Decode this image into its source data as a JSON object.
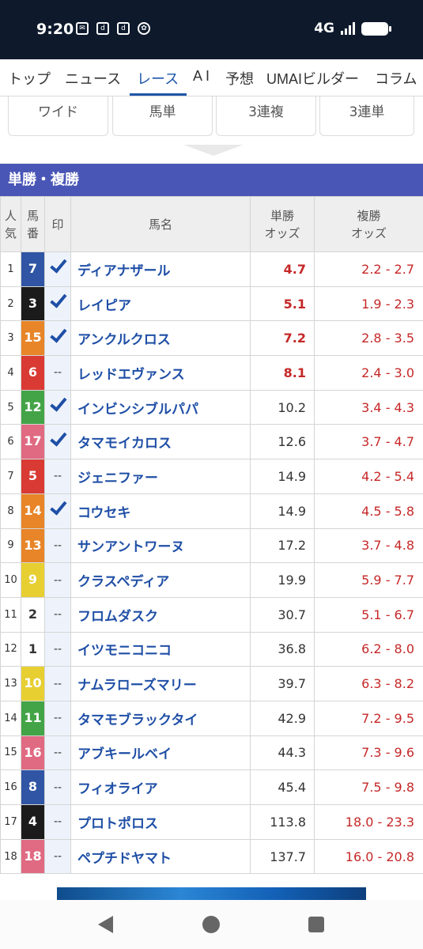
{
  "status": {
    "time": "9:20",
    "network": "4G",
    "left_icons": [
      "mail-icon",
      "d-icon",
      "d-icon",
      "pinwheel-icon"
    ]
  },
  "nav": {
    "items": [
      "トップ",
      "ニュース",
      "レース",
      "A I",
      "予想",
      "UMAIビルダー",
      "コラム"
    ],
    "active": "レース"
  },
  "bet_tabs": [
    "ワイド",
    "馬単",
    "3連複",
    "3連単"
  ],
  "section_title": "単勝・複勝",
  "table": {
    "headers": {
      "pop": [
        "人",
        "気"
      ],
      "num": [
        "馬",
        "番"
      ],
      "mark": "印",
      "name": "馬名",
      "win": [
        "単勝",
        "オッズ"
      ],
      "place": [
        "複勝",
        "オッズ"
      ]
    },
    "rows": [
      {
        "pop": "1",
        "num": "7",
        "mark": "check",
        "name": "ディアナザール",
        "win": "4.7",
        "place": "2.2 - 2.7",
        "win_hi": true,
        "bg": "#2f55a4",
        "fg": "#ffffff"
      },
      {
        "pop": "2",
        "num": "3",
        "mark": "check",
        "name": "レイピア",
        "win": "5.1",
        "place": "1.9 - 2.3",
        "win_hi": true,
        "bg": "#1b1b1b",
        "fg": "#ffffff"
      },
      {
        "pop": "3",
        "num": "15",
        "mark": "check",
        "name": "アンクルクロス",
        "win": "7.2",
        "place": "2.8 - 3.5",
        "win_hi": true,
        "bg": "#e78528",
        "fg": "#ffffff"
      },
      {
        "pop": "4",
        "num": "6",
        "mark": "--",
        "name": "レッドエヴァンス",
        "win": "8.1",
        "place": "2.4 - 3.0",
        "win_hi": true,
        "bg": "#d93a34",
        "fg": "#ffffff"
      },
      {
        "pop": "5",
        "num": "12",
        "mark": "check",
        "name": "インビンシブルパパ",
        "win": "10.2",
        "place": "3.4 - 4.3",
        "win_hi": false,
        "bg": "#43a447",
        "fg": "#ffffff"
      },
      {
        "pop": "6",
        "num": "17",
        "mark": "check",
        "name": "タマモイカロス",
        "win": "12.6",
        "place": "3.7 - 4.7",
        "win_hi": false,
        "bg": "#e06a82",
        "fg": "#ffffff"
      },
      {
        "pop": "7",
        "num": "5",
        "mark": "--",
        "name": "ジェニファー",
        "win": "14.9",
        "place": "4.2 - 5.4",
        "win_hi": false,
        "bg": "#d93a34",
        "fg": "#ffffff"
      },
      {
        "pop": "8",
        "num": "14",
        "mark": "check",
        "name": "コウセキ",
        "win": "14.9",
        "place": "4.5 - 5.8",
        "win_hi": false,
        "bg": "#e78528",
        "fg": "#ffffff"
      },
      {
        "pop": "9",
        "num": "13",
        "mark": "--",
        "name": "サンアントワーヌ",
        "win": "17.2",
        "place": "3.7 - 4.8",
        "win_hi": false,
        "bg": "#e78528",
        "fg": "#ffffff"
      },
      {
        "pop": "10",
        "num": "9",
        "mark": "--",
        "name": "クラスペディア",
        "win": "19.9",
        "place": "5.9 - 7.7",
        "win_hi": false,
        "bg": "#e7cf32",
        "fg": "#ffffff"
      },
      {
        "pop": "11",
        "num": "2",
        "mark": "--",
        "name": "フロムダスク",
        "win": "30.7",
        "place": "5.1 - 6.7",
        "win_hi": false,
        "bg": "#ffffff",
        "fg": "#333333"
      },
      {
        "pop": "12",
        "num": "1",
        "mark": "--",
        "name": "イツモニコニコ",
        "win": "36.8",
        "place": "6.2 - 8.0",
        "win_hi": false,
        "bg": "#ffffff",
        "fg": "#333333"
      },
      {
        "pop": "13",
        "num": "10",
        "mark": "--",
        "name": "ナムラローズマリー",
        "win": "39.7",
        "place": "6.3 - 8.2",
        "win_hi": false,
        "bg": "#e7cf32",
        "fg": "#ffffff"
      },
      {
        "pop": "14",
        "num": "11",
        "mark": "--",
        "name": "タマモブラックタイ",
        "win": "42.9",
        "place": "7.2 - 9.5",
        "win_hi": false,
        "bg": "#43a447",
        "fg": "#ffffff"
      },
      {
        "pop": "15",
        "num": "16",
        "mark": "--",
        "name": "アブキールベイ",
        "win": "44.3",
        "place": "7.3 - 9.6",
        "win_hi": false,
        "bg": "#e06a82",
        "fg": "#ffffff"
      },
      {
        "pop": "16",
        "num": "8",
        "mark": "--",
        "name": "フィオライア",
        "win": "45.4",
        "place": "7.5 - 9.8",
        "win_hi": false,
        "bg": "#2f55a4",
        "fg": "#ffffff"
      },
      {
        "pop": "17",
        "num": "4",
        "mark": "--",
        "name": "プロトポロス",
        "win": "113.8",
        "place": "18.0 - 23.3",
        "win_hi": false,
        "bg": "#1b1b1b",
        "fg": "#ffffff"
      },
      {
        "pop": "18",
        "num": "18",
        "mark": "--",
        "name": "ペプチドヤマト",
        "win": "137.7",
        "place": "16.0 - 20.8",
        "win_hi": false,
        "bg": "#e06a82",
        "fg": "#ffffff"
      }
    ]
  },
  "colors": {
    "accent": "#1e56a8",
    "section": "#4a56b6",
    "odds_red": "#c62828",
    "name_blue": "#1f4fa6"
  }
}
